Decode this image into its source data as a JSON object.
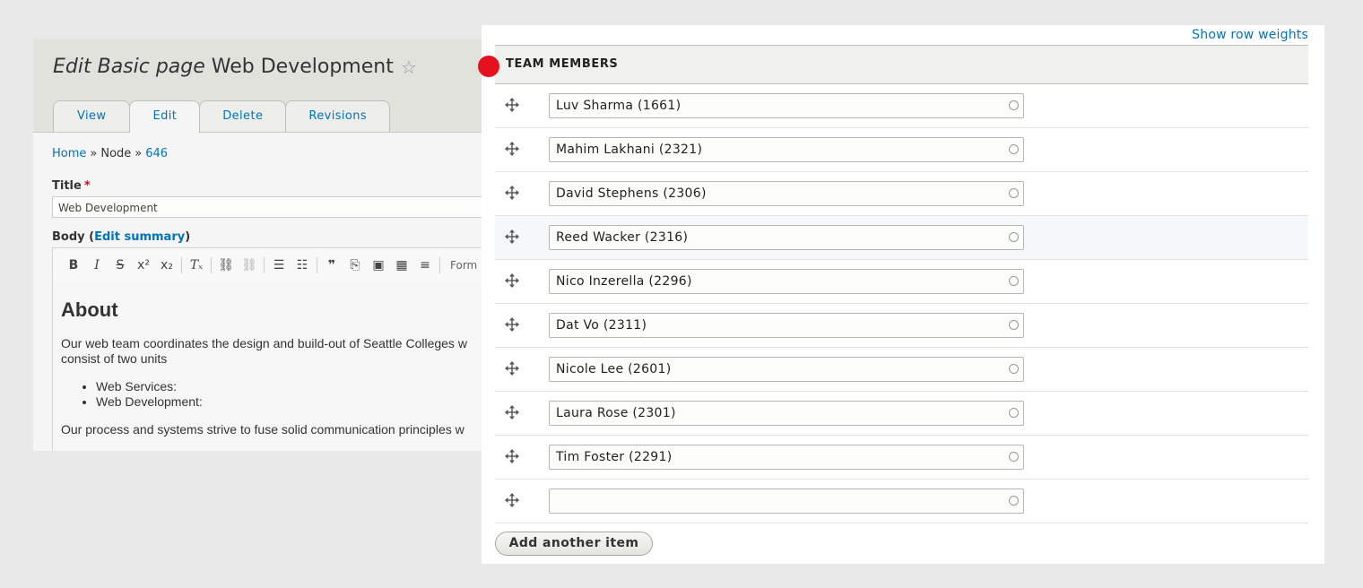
{
  "header": {
    "title_prefix": "Edit Basic page",
    "title_name": "Web Development",
    "tabs": [
      "View",
      "Edit",
      "Delete",
      "Revisions"
    ],
    "active_tab": "Edit"
  },
  "breadcrumb": [
    "Home",
    "Node",
    "646"
  ],
  "form": {
    "title_label": "Title",
    "required_mark": "*",
    "title_value": "Web Development",
    "body_label_pre": "Body (",
    "body_label_link": "Edit summary",
    "body_label_post": ")",
    "toolbar_format": "Form"
  },
  "editor": {
    "heading": "About",
    "para1_line1": "Our web team coordinates the design and build-out of Seattle Colleges w",
    "para1_line2": "consist of two units",
    "list": [
      "Web Services:",
      "Web Development:"
    ],
    "para2": "Our process and systems strive to fuse solid communication principles w"
  },
  "panel": {
    "show_row_weights": "Show row weights",
    "section_title": "TEAM MEMBERS",
    "members": [
      "Luv Sharma (1661)",
      "Mahim Lakhani (2321)",
      "David Stephens (2306)",
      "Reed Wacker (2316)",
      "Nico Inzerella (2296)",
      "Dat Vo (2311)",
      "Nicole Lee (2601)",
      "Laura Rose (2301)",
      "Tim Foster (2291)",
      ""
    ],
    "add_button": "Add another item",
    "marker_color": "#e5111f"
  }
}
